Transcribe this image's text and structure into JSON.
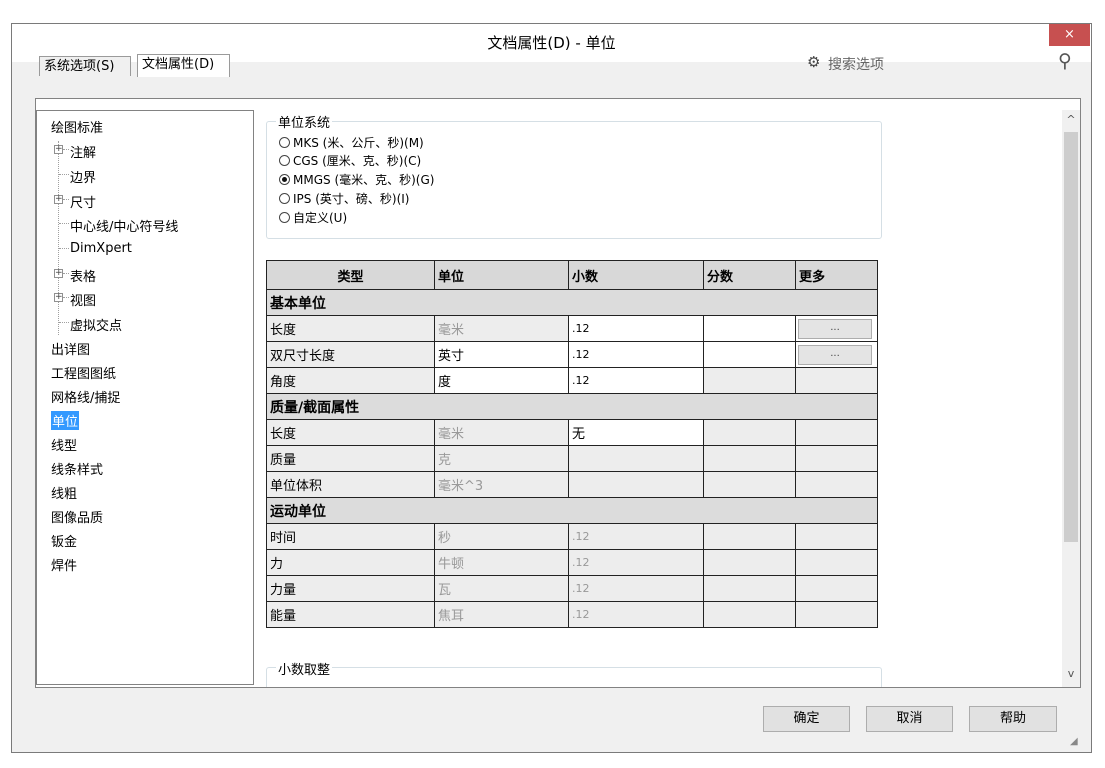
{
  "window": {
    "title": "文档属性(D) - 单位",
    "close": "×"
  },
  "tabs": [
    {
      "label": "系统选项(S)",
      "active": false
    },
    {
      "label": "文档属性(D)",
      "active": true
    }
  ],
  "search": {
    "placeholder": "搜索选项"
  },
  "tree": [
    "绘图标准",
    "注解",
    "边界",
    "尺寸",
    "中心线/中心符号线",
    "DimXpert",
    "表格",
    "视图",
    "虚拟交点",
    "出详图",
    "工程图图纸",
    "网格线/捕捉",
    "单位",
    "线型",
    "线条样式",
    "线粗",
    "图像品质",
    "钣金",
    "焊件"
  ],
  "unit_system": {
    "label": "单位系统",
    "options": [
      "MKS (米、公斤、秒)(M)",
      "CGS (厘米、克、秒)(C)",
      "MMGS (毫米、克、秒)(G)",
      "IPS (英寸、磅、秒)(I)",
      "自定义(U)"
    ],
    "selected_index": 2
  },
  "table": {
    "headers": [
      "类型",
      "单位",
      "小数",
      "分数",
      "更多"
    ],
    "sections": {
      "basic": "基本单位",
      "mass": "质量/截面属性",
      "motion": "运动单位"
    },
    "rows": {
      "length": [
        "长度",
        "毫米",
        ".12",
        "",
        "..."
      ],
      "dual": [
        "双尺寸长度",
        "英寸",
        ".12",
        "",
        "..."
      ],
      "angle": [
        "角度",
        "度",
        ".12",
        "",
        ""
      ],
      "m_length": [
        "长度",
        "毫米",
        "无",
        "",
        ""
      ],
      "mass": [
        "质量",
        "克",
        "",
        "",
        ""
      ],
      "volume": [
        "单位体积",
        "毫米^3",
        "",
        "",
        ""
      ],
      "time": [
        "时间",
        "秒",
        ".12",
        "",
        ""
      ],
      "force": [
        "力",
        "牛顿",
        ".12",
        "",
        ""
      ],
      "power": [
        "力量",
        "瓦",
        ".12",
        "",
        ""
      ],
      "energy": [
        "能量",
        "焦耳",
        ".12",
        "",
        ""
      ]
    }
  },
  "rounding": {
    "label": "小数取整"
  },
  "buttons": {
    "ok": "确定",
    "cancel": "取消",
    "help": "帮助"
  },
  "scroll": {
    "up": "^",
    "down": "v"
  },
  "icons": {
    "gear": "⚙",
    "magnifier": "⚲",
    "grip": "◢"
  }
}
